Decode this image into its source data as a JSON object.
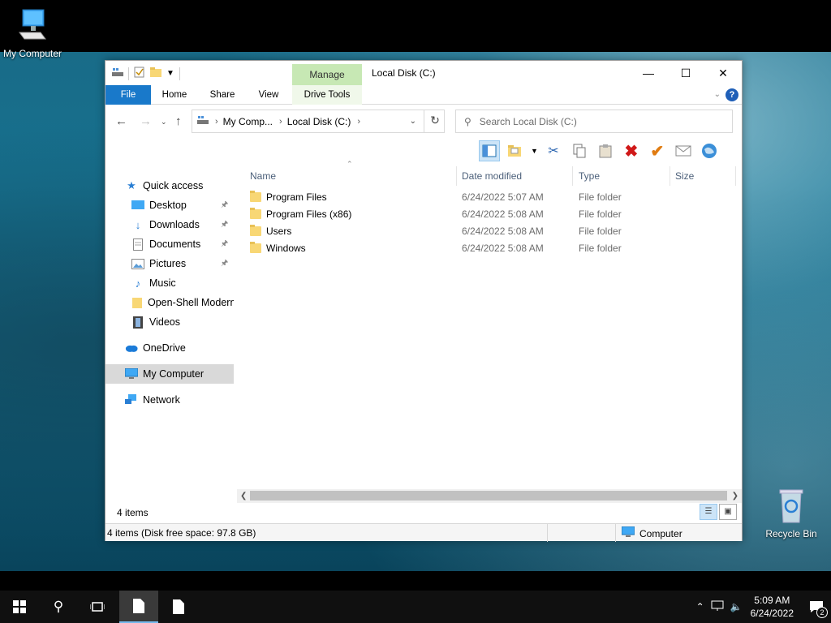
{
  "desktop": {
    "my_computer_label": "My Computer",
    "recycle_bin_label": "Recycle Bin"
  },
  "window": {
    "title": "Local Disk (C:)",
    "context_group": "Manage",
    "tabs": {
      "file": "File",
      "home": "Home",
      "share": "Share",
      "view": "View",
      "drive_tools": "Drive Tools"
    },
    "address": {
      "crumb1": "My Comp...",
      "crumb2": "Local Disk (C:)"
    },
    "search_placeholder": "Search Local Disk (C:)",
    "columns": {
      "name": "Name",
      "date": "Date modified",
      "type": "Type",
      "size": "Size"
    },
    "files": [
      {
        "name": "Program Files",
        "date": "6/24/2022 5:07 AM",
        "type": "File folder"
      },
      {
        "name": "Program Files (x86)",
        "date": "6/24/2022 5:08 AM",
        "type": "File folder"
      },
      {
        "name": "Users",
        "date": "6/24/2022 5:08 AM",
        "type": "File folder"
      },
      {
        "name": "Windows",
        "date": "6/24/2022 5:08 AM",
        "type": "File folder"
      }
    ],
    "nav": {
      "quick_access": "Quick access",
      "desktop": "Desktop",
      "downloads": "Downloads",
      "documents": "Documents",
      "pictures": "Pictures",
      "music": "Music",
      "openshell": "Open-Shell Modern",
      "videos": "Videos",
      "onedrive": "OneDrive",
      "my_computer": "My Computer",
      "network": "Network"
    },
    "item_count": "4 items",
    "statusbar_left": "4 items (Disk free space: 97.8 GB)",
    "statusbar_right": "Computer"
  },
  "taskbar": {
    "time": "5:09 AM",
    "date": "6/24/2022",
    "notification_count": "2"
  },
  "colors": {
    "file_tab": "#1979ca",
    "context_group": "#c7e8b4",
    "folder": "#f8d775"
  }
}
